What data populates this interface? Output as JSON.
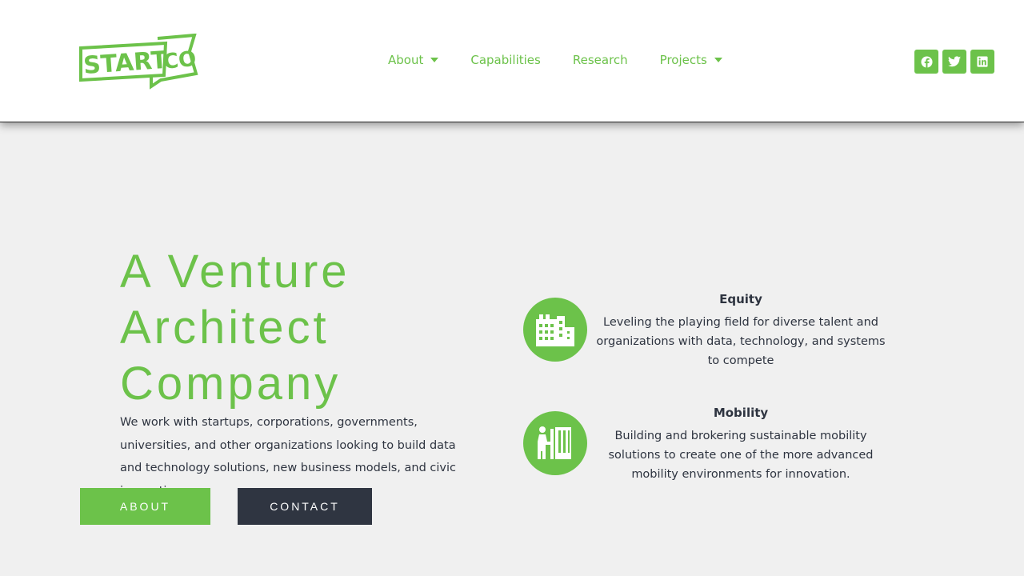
{
  "brand": {
    "logo_text": "START CO",
    "accent": "#6cc24a",
    "dark": "#2f3541"
  },
  "nav": {
    "items": [
      {
        "label": "About",
        "has_dropdown": true
      },
      {
        "label": "Capabilities",
        "has_dropdown": false
      },
      {
        "label": "Research",
        "has_dropdown": false
      },
      {
        "label": "Projects",
        "has_dropdown": true
      }
    ]
  },
  "social": [
    {
      "icon": "facebook-icon"
    },
    {
      "icon": "twitter-icon"
    },
    {
      "icon": "linkedin-icon"
    }
  ],
  "hero": {
    "title_line1": "A Venture",
    "title_line2": "Architect",
    "title_line3": "Company",
    "description": "We work with startups, corporations, governments, universities, and other organizations looking to build data and technology solutions, new business models, and civic innovations.",
    "about_button": "ABOUT",
    "contact_button": "CONTACT"
  },
  "features": [
    {
      "icon": "buildings-icon",
      "title": "Equity",
      "body": "Leveling the playing field for diverse talent and organizations with data, technology, and systems to compete"
    },
    {
      "icon": "person-door-icon",
      "title": "Mobility",
      "body": "Building and brokering sustainable mobility solutions to create one of the more advanced mobility environments for innovation."
    }
  ]
}
